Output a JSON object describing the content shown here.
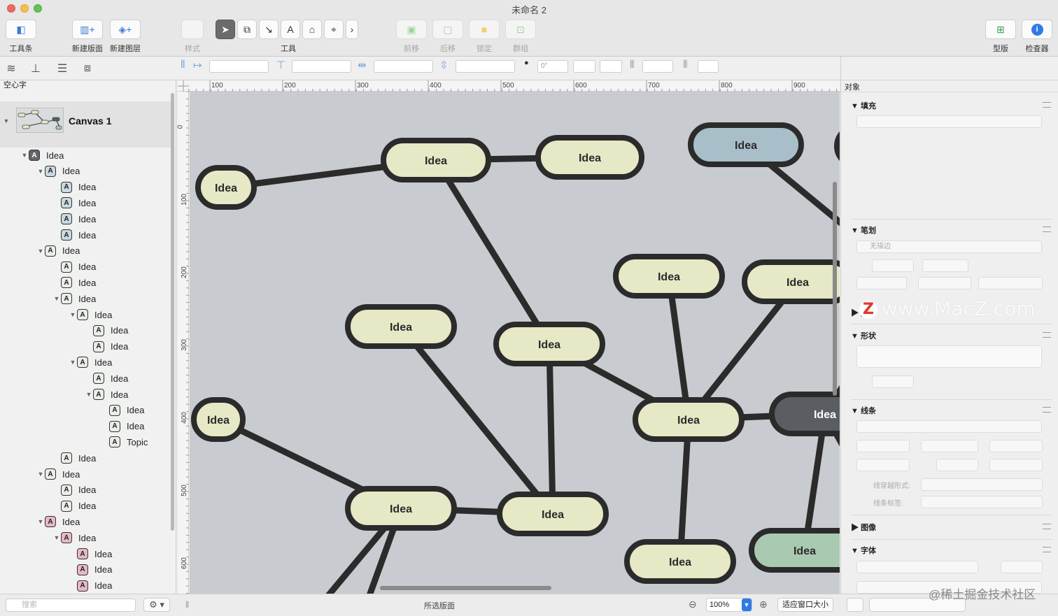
{
  "window": {
    "title": "未命名 2"
  },
  "toolbar": {
    "toolbar_label": "工具条",
    "new_canvas_label": "新建版面",
    "new_layer_label": "新建图层",
    "style_label": "样式",
    "tools_label": "工具",
    "bring_front_label": "前移",
    "send_back_label": "后移",
    "lock_label": "锁定",
    "group_label": "群组",
    "stencils_label": "型版",
    "inspector_label": "检查器",
    "tool_text_glyph": "A"
  },
  "subbar": {
    "rotation_value": "0°"
  },
  "left_panel": {
    "header": "空心字",
    "canvas_name": "Canvas 1",
    "badge_letter": "A",
    "tree": [
      {
        "label": "Idea",
        "depth": 0,
        "tri": "▼",
        "badge": "dark"
      },
      {
        "label": "Idea",
        "depth": 1,
        "tri": "▼",
        "badge": "blue"
      },
      {
        "label": "Idea",
        "depth": 2,
        "tri": "",
        "badge": "blue"
      },
      {
        "label": "Idea",
        "depth": 2,
        "tri": "",
        "badge": "blue"
      },
      {
        "label": "Idea",
        "depth": 2,
        "tri": "",
        "badge": "blue"
      },
      {
        "label": "Idea",
        "depth": 2,
        "tri": "",
        "badge": "blue"
      },
      {
        "label": "Idea",
        "depth": 1,
        "tri": "▼",
        "badge": "green"
      },
      {
        "label": "Idea",
        "depth": 2,
        "tri": "",
        "badge": "green"
      },
      {
        "label": "Idea",
        "depth": 2,
        "tri": "",
        "badge": "green"
      },
      {
        "label": "Idea",
        "depth": 2,
        "tri": "▼",
        "badge": "green"
      },
      {
        "label": "Idea",
        "depth": 3,
        "tri": "▼",
        "badge": "green"
      },
      {
        "label": "Idea",
        "depth": 4,
        "tri": "",
        "badge": "green"
      },
      {
        "label": "Idea",
        "depth": 4,
        "tri": "",
        "badge": "green"
      },
      {
        "label": "Idea",
        "depth": 3,
        "tri": "▼",
        "badge": "green"
      },
      {
        "label": "Idea",
        "depth": 4,
        "tri": "",
        "badge": "green"
      },
      {
        "label": "Idea",
        "depth": 4,
        "tri": "▼",
        "badge": "green"
      },
      {
        "label": "Idea",
        "depth": 5,
        "tri": "",
        "badge": "green"
      },
      {
        "label": "Idea",
        "depth": 5,
        "tri": "",
        "badge": "green"
      },
      {
        "label": "Topic",
        "depth": 5,
        "tri": "",
        "badge": "green"
      },
      {
        "label": "Idea",
        "depth": 2,
        "tri": "",
        "badge": "green"
      },
      {
        "label": "Idea",
        "depth": 1,
        "tri": "▼",
        "badge": "green"
      },
      {
        "label": "Idea",
        "depth": 2,
        "tri": "",
        "badge": "green"
      },
      {
        "label": "Idea",
        "depth": 2,
        "tri": "",
        "badge": "green"
      },
      {
        "label": "Idea",
        "depth": 1,
        "tri": "▼",
        "badge": "pink"
      },
      {
        "label": "Idea",
        "depth": 2,
        "tri": "▼",
        "badge": "pink"
      },
      {
        "label": "Idea",
        "depth": 3,
        "tri": "",
        "badge": "pink"
      },
      {
        "label": "Idea",
        "depth": 3,
        "tri": "",
        "badge": "pink"
      },
      {
        "label": "Idea",
        "depth": 3,
        "tri": "",
        "badge": "pink"
      }
    ],
    "search_placeholder": "搜索"
  },
  "rulers": {
    "h_ticks": [
      "100",
      "200",
      "300",
      "400",
      "500",
      "600",
      "700",
      "800",
      "900"
    ],
    "v_ticks": [
      "0",
      "100",
      "200",
      "300",
      "400",
      "500",
      "600"
    ]
  },
  "canvas": {
    "node_label": "Idea",
    "colors": {
      "bg": "#c8cbcf",
      "cream": "#e6e8c6",
      "blue": "#a8bfc9",
      "dark": "#5a5e63",
      "green": "#a9c9b1",
      "line": "#2b2b2b"
    }
  },
  "inspector": {
    "object_label": "对象",
    "fill": "填充",
    "stroke": "笔划",
    "no_stroke": "无描边",
    "shadow": "阴影",
    "shape": "形状",
    "lines": "线条",
    "line_hops": "线穿越形式:",
    "line_label": "线条标签:",
    "image": "图像",
    "font": "字体"
  },
  "statusbar": {
    "selected_canvas": "所选版面",
    "zoom": "100%",
    "fit_window": "适应窗口大小"
  },
  "watermarks": {
    "macz": "www.MacZ.com",
    "macz_logo": "Z",
    "juejin": "@稀土掘金技术社区"
  }
}
